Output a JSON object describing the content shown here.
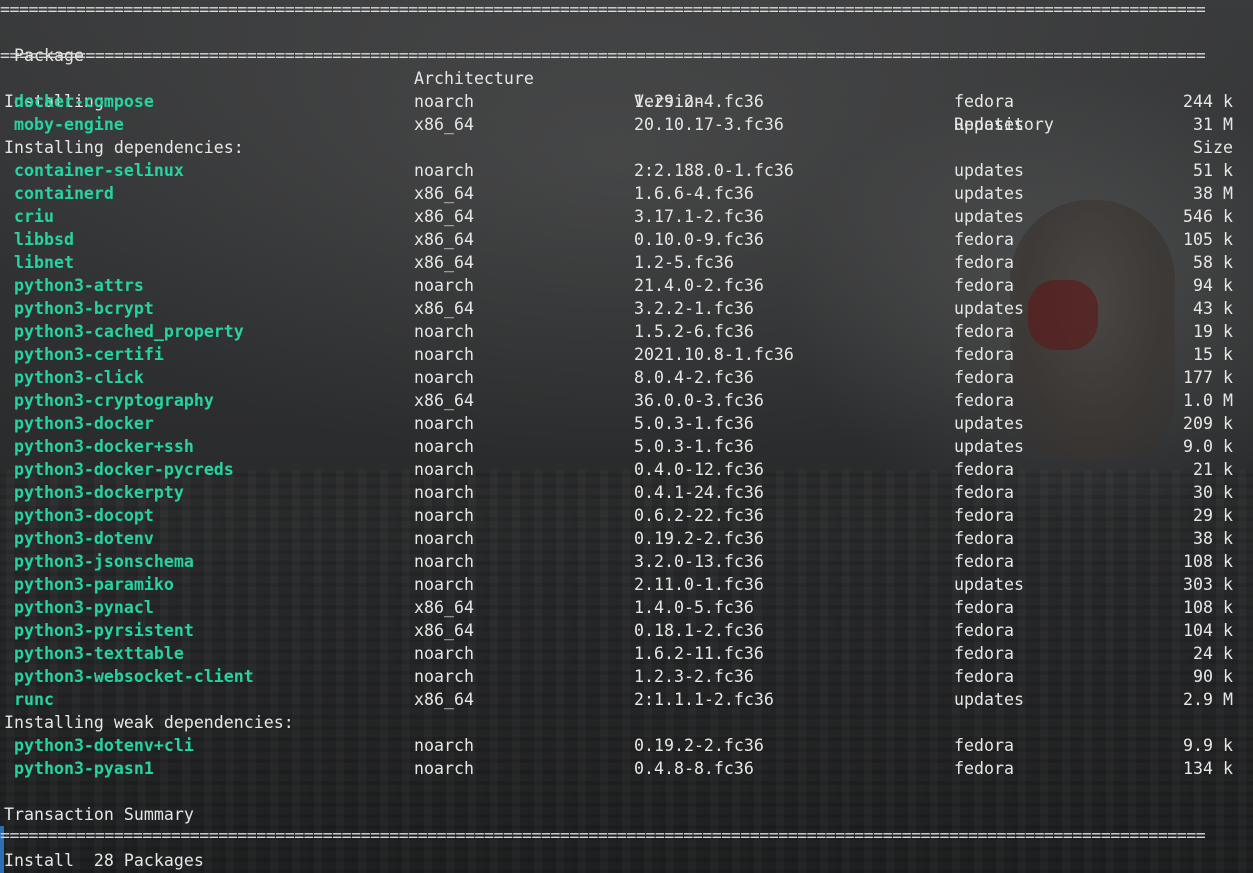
{
  "separator": "===============================================================================================================================",
  "header": {
    "package": "Package",
    "architecture": "Architecture",
    "version": "Version",
    "repository": "Repository",
    "size": "Size"
  },
  "installing_label": "Installing:",
  "installing": [
    {
      "name": "docker-compose",
      "arch": "noarch",
      "version": "1.29.2-4.fc36",
      "repo": "fedora",
      "size": "244 k"
    },
    {
      "name": "moby-engine",
      "arch": "x86_64",
      "version": "20.10.17-3.fc36",
      "repo": "updates",
      "size": "31 M"
    }
  ],
  "deps_label": "Installing dependencies:",
  "dependencies": [
    {
      "name": "container-selinux",
      "arch": "noarch",
      "version": "2:2.188.0-1.fc36",
      "repo": "updates",
      "size": "51 k"
    },
    {
      "name": "containerd",
      "arch": "x86_64",
      "version": "1.6.6-4.fc36",
      "repo": "updates",
      "size": "38 M"
    },
    {
      "name": "criu",
      "arch": "x86_64",
      "version": "3.17.1-2.fc36",
      "repo": "updates",
      "size": "546 k"
    },
    {
      "name": "libbsd",
      "arch": "x86_64",
      "version": "0.10.0-9.fc36",
      "repo": "fedora",
      "size": "105 k"
    },
    {
      "name": "libnet",
      "arch": "x86_64",
      "version": "1.2-5.fc36",
      "repo": "fedora",
      "size": "58 k"
    },
    {
      "name": "python3-attrs",
      "arch": "noarch",
      "version": "21.4.0-2.fc36",
      "repo": "fedora",
      "size": "94 k"
    },
    {
      "name": "python3-bcrypt",
      "arch": "x86_64",
      "version": "3.2.2-1.fc36",
      "repo": "updates",
      "size": "43 k"
    },
    {
      "name": "python3-cached_property",
      "arch": "noarch",
      "version": "1.5.2-6.fc36",
      "repo": "fedora",
      "size": "19 k"
    },
    {
      "name": "python3-certifi",
      "arch": "noarch",
      "version": "2021.10.8-1.fc36",
      "repo": "fedora",
      "size": "15 k"
    },
    {
      "name": "python3-click",
      "arch": "noarch",
      "version": "8.0.4-2.fc36",
      "repo": "fedora",
      "size": "177 k"
    },
    {
      "name": "python3-cryptography",
      "arch": "x86_64",
      "version": "36.0.0-3.fc36",
      "repo": "fedora",
      "size": "1.0 M"
    },
    {
      "name": "python3-docker",
      "arch": "noarch",
      "version": "5.0.3-1.fc36",
      "repo": "updates",
      "size": "209 k"
    },
    {
      "name": "python3-docker+ssh",
      "arch": "noarch",
      "version": "5.0.3-1.fc36",
      "repo": "updates",
      "size": "9.0 k"
    },
    {
      "name": "python3-docker-pycreds",
      "arch": "noarch",
      "version": "0.4.0-12.fc36",
      "repo": "fedora",
      "size": "21 k"
    },
    {
      "name": "python3-dockerpty",
      "arch": "noarch",
      "version": "0.4.1-24.fc36",
      "repo": "fedora",
      "size": "30 k"
    },
    {
      "name": "python3-docopt",
      "arch": "noarch",
      "version": "0.6.2-22.fc36",
      "repo": "fedora",
      "size": "29 k"
    },
    {
      "name": "python3-dotenv",
      "arch": "noarch",
      "version": "0.19.2-2.fc36",
      "repo": "fedora",
      "size": "38 k"
    },
    {
      "name": "python3-jsonschema",
      "arch": "noarch",
      "version": "3.2.0-13.fc36",
      "repo": "fedora",
      "size": "108 k"
    },
    {
      "name": "python3-paramiko",
      "arch": "noarch",
      "version": "2.11.0-1.fc36",
      "repo": "updates",
      "size": "303 k"
    },
    {
      "name": "python3-pynacl",
      "arch": "x86_64",
      "version": "1.4.0-5.fc36",
      "repo": "fedora",
      "size": "108 k"
    },
    {
      "name": "python3-pyrsistent",
      "arch": "x86_64",
      "version": "0.18.1-2.fc36",
      "repo": "fedora",
      "size": "104 k"
    },
    {
      "name": "python3-texttable",
      "arch": "noarch",
      "version": "1.6.2-11.fc36",
      "repo": "fedora",
      "size": "24 k"
    },
    {
      "name": "python3-websocket-client",
      "arch": "noarch",
      "version": "1.2.3-2.fc36",
      "repo": "fedora",
      "size": "90 k"
    },
    {
      "name": "runc",
      "arch": "x86_64",
      "version": "2:1.1.1-2.fc36",
      "repo": "updates",
      "size": "2.9 M"
    }
  ],
  "weak_label": "Installing weak dependencies:",
  "weak": [
    {
      "name": "python3-dotenv+cli",
      "arch": "noarch",
      "version": "0.19.2-2.fc36",
      "repo": "fedora",
      "size": "9.9 k"
    },
    {
      "name": "python3-pyasn1",
      "arch": "noarch",
      "version": "0.4.8-8.fc36",
      "repo": "fedora",
      "size": "134 k"
    }
  ],
  "summary_label": "Transaction Summary",
  "install_line": "Install  28 Packages",
  "colors": {
    "package_green": "#26d3a1",
    "text": "#e6e6e6"
  }
}
